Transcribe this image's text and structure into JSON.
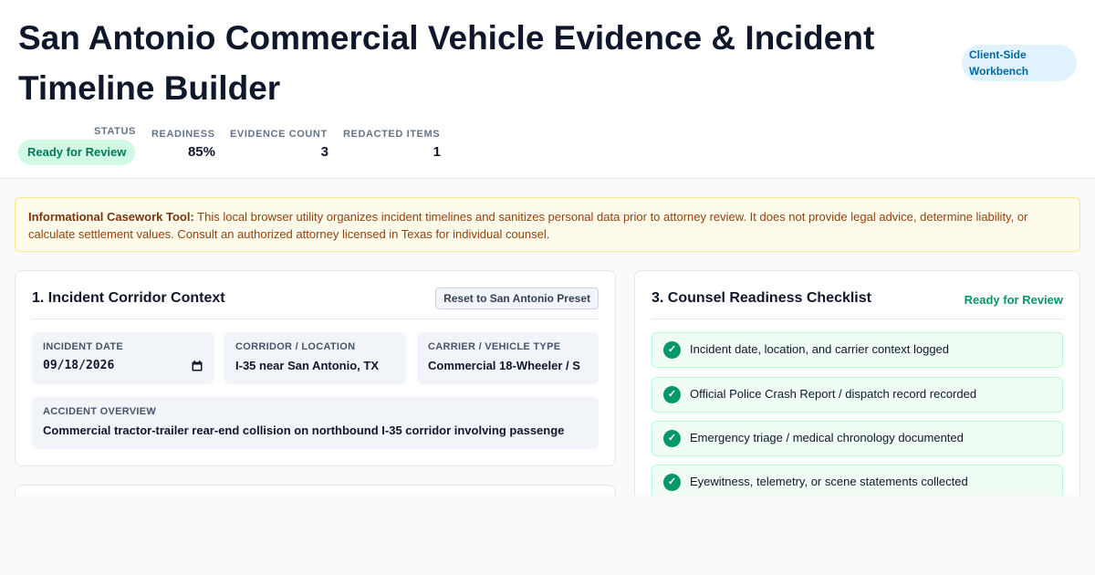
{
  "header": {
    "title": "San Antonio Commercial Vehicle Evidence & Incident Timeline Builder",
    "workbench_badge": "Client-Side Workbench",
    "stats": {
      "status_label": "STATUS",
      "status_value": "Ready for Review",
      "readiness_label": "READINESS",
      "readiness_value": "85%",
      "evidence_label": "EVIDENCE COUNT",
      "evidence_value": "3",
      "redacted_label": "REDACTED ITEMS",
      "redacted_value": "1"
    },
    "colors": {
      "status_bg": "#d1fae5",
      "status_text": "#047857",
      "badge_bg": "#e0f2fe",
      "badge_text": "#0369a1"
    }
  },
  "notice": {
    "lead": "Informational Casework Tool:",
    "body": " This local browser utility organizes incident timelines and sanitizes personal data prior to attorney review. It does not provide legal advice, determine liability, or calculate settlement values. Consult an authorized attorney licensed in Texas for individual counsel."
  },
  "corridor": {
    "title": "1. Incident Corridor Context",
    "reset_label": "Reset to San Antonio Preset",
    "date_label": "INCIDENT DATE",
    "date_value": "09/18/2026",
    "date_icon": "calendar-icon",
    "location_label": "CORRIDOR / LOCATION",
    "location_value": "I-35 near San Antonio, TX",
    "carrier_label": "CARRIER / VEHICLE TYPE",
    "carrier_value": "Commercial 18-Wheeler / S",
    "overview_label": "ACCIDENT OVERVIEW",
    "overview_value": "Commercial tractor-trailer rear-end collision on northbound I-35 corridor involving passenge"
  },
  "checklist": {
    "title": "3. Counsel Readiness Checklist",
    "status": "Ready for Review",
    "check_icon": "check-icon",
    "items": [
      {
        "label": "Incident date, location, and carrier context logged",
        "done": true
      },
      {
        "label": "Official Police Crash Report / dispatch record recorded",
        "done": true
      },
      {
        "label": "Emergency triage / medical chronology documented",
        "done": true
      },
      {
        "label": "Eyewitness, telemetry, or scene statements collected",
        "done": true
      }
    ]
  }
}
